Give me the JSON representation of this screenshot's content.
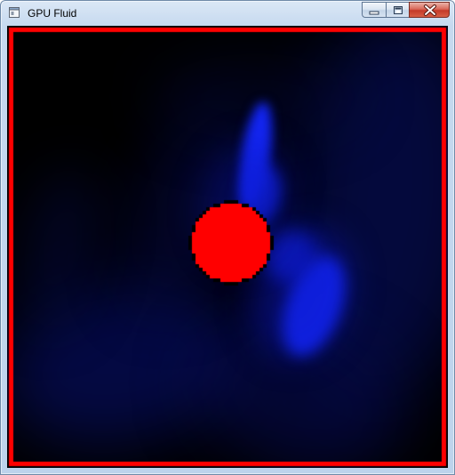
{
  "window": {
    "title": "GPU Fluid",
    "app_icon": "window-app-icon",
    "controls": {
      "minimize": "minimize-icon",
      "maximize": "maximize-icon",
      "close": "close-icon"
    }
  },
  "simulation": {
    "border_color": "#ff0000",
    "obstacle_color": "#ff0000",
    "fluid_color": "#0a1cff",
    "background_color": "#000000"
  }
}
